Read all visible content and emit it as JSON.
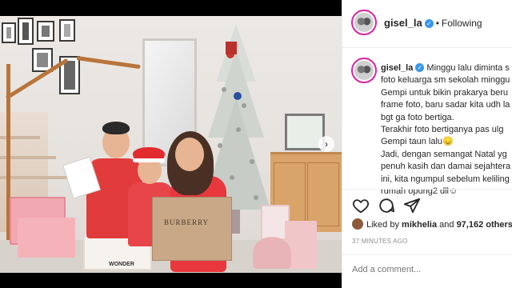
{
  "post": {
    "username": "gisel_la",
    "follow_status": "Following",
    "caption_lines": [
      "Minggu lalu diminta s",
      "foto keluarga sm sekolah minggu",
      "Gempi untuk bikin prakarya beru",
      "frame foto, baru sadar kita udh la",
      "bgt ga foto bertiga.",
      "Terakhir foto bertiganya pas ulg",
      "Gempi taun lalu😞",
      "Jadi, dengan semangat Natal yg",
      "penuh kasih dan damai sejahtera",
      "ini, kita ngumpul sebelum keliling",
      "rumah opung2 dll☺"
    ],
    "likes_prefix": "Liked by",
    "liked_by_user": "mikhelia",
    "likes_joiner": "and",
    "likes_count": "97,162 others",
    "timestamp": "37 MINUTES AGO",
    "comment_placeholder": "Add a comment..."
  },
  "photo": {
    "bag_text": "BURBERRY",
    "box_text": "WONDER"
  },
  "icons": {
    "verified": "verified-badge-icon",
    "like": "heart-icon",
    "comment": "comment-icon",
    "share": "share-icon",
    "next": "chevron-right-icon"
  },
  "colors": {
    "verified_blue": "#3897f0",
    "story_ring": "#d6249f",
    "text": "#262626",
    "muted": "#8e8e8e"
  }
}
